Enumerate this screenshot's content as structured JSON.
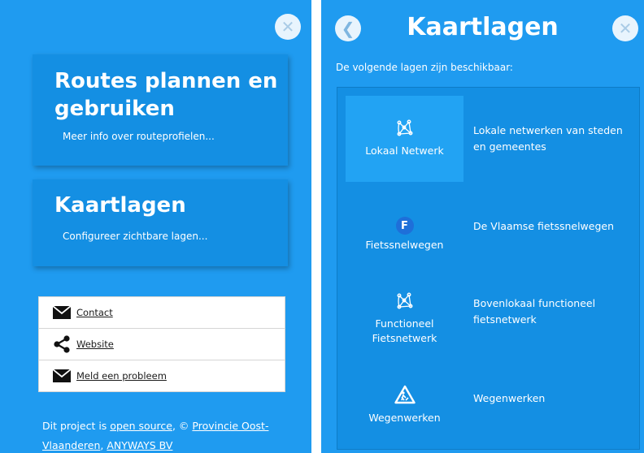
{
  "left": {
    "close_glyph": "✕",
    "cards": [
      {
        "title_line1": "Routes plannen en",
        "title_line2": "gebruiken",
        "subtitle": "Meer info over routeprofielen..."
      },
      {
        "title": "Kaartlagen",
        "subtitle": "Configureer zichtbare lagen..."
      }
    ],
    "links": [
      {
        "icon": "envelope-icon",
        "label": "Contact"
      },
      {
        "icon": "share-icon",
        "label": "Website"
      },
      {
        "icon": "envelope-icon",
        "label": "Meld een probleem"
      }
    ],
    "footer": {
      "prefix": "Dit project is ",
      "link1": "open source",
      "mid": ", © ",
      "link2a": "Provincie Oost-",
      "link2b": "Vlaanderen",
      "sep": ", ",
      "link3": "ANYWAYS BV"
    }
  },
  "right": {
    "back_glyph": "❮",
    "close_glyph": "✕",
    "title": "Kaartlagen",
    "intro": "De volgende lagen zijn beschikbaar:",
    "layers": [
      {
        "name": "Lokaal Netwerk",
        "description": "Lokale netwerken van steden en gemeentes",
        "icon": "network-icon",
        "active": true
      },
      {
        "name": "Fietssnelwegen",
        "description": "De Vlaamse fietssnelwegen",
        "icon": "f-badge-icon",
        "badge": "F",
        "active": false
      },
      {
        "name_line1": "Functioneel",
        "name_line2": "Fietsnetwerk",
        "description": "Bovenlokaal functioneel fietsnetwerk",
        "icon": "network-icon",
        "active": false
      },
      {
        "name": "Wegenwerken",
        "description": "Wegenwerken",
        "icon": "roadworks-sign-icon",
        "active": false
      }
    ]
  },
  "colors": {
    "panel_blue": "#1f9bf0",
    "card_blue": "#148fe3",
    "active_blue": "#22a3f3",
    "badge_blue": "#1e6fd9"
  }
}
